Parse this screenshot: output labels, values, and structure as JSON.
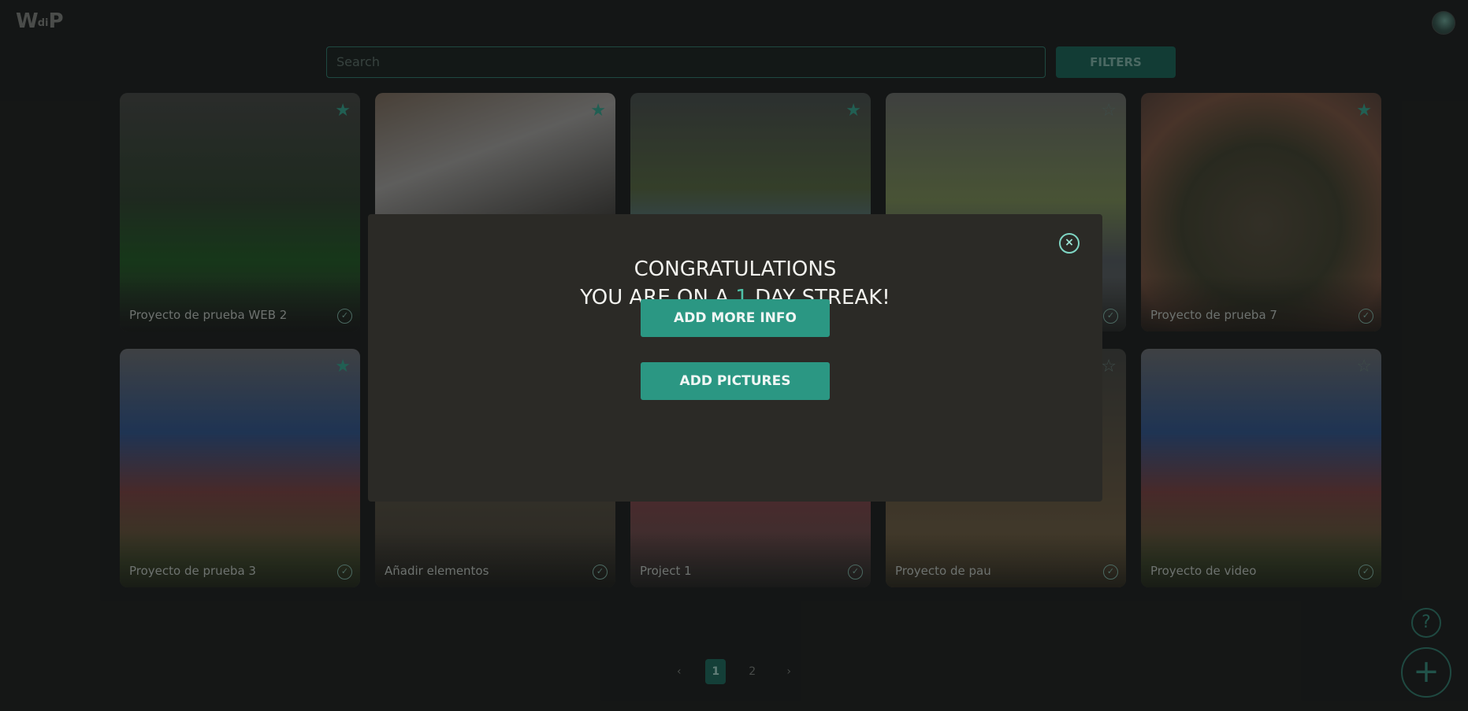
{
  "app": {
    "logo_main": "W",
    "logo_small": "di",
    "logo_end": "P"
  },
  "search": {
    "placeholder": "Search"
  },
  "filters_label": "FILTERS",
  "cards": [
    {
      "title": "Proyecto de prueba WEB 2",
      "favorite": true,
      "art": "linear-gradient(180deg,#3d3e3c 0%,#2a3a2a 45%,#1f4f22 70%,#2c2d2b 100%)"
    },
    {
      "title": "",
      "favorite": true,
      "art": "linear-gradient(160deg,#6b5d50 0%,#8c8a88 30%,#3c3a37 65%,#6d5a4b 100%)"
    },
    {
      "title": "",
      "favorite": true,
      "art": "linear-gradient(180deg,#3f4443 0%,#4c5a3a 40%,#4d6b8a 65%,#3a3b39 100%)"
    },
    {
      "title": "",
      "favorite": false,
      "art": "linear-gradient(180deg,#5b5d5a 0%,#6b7a4c 45%,#4a4f53 70%,#555755 100%)"
    },
    {
      "title": "Proyecto de prueba 7",
      "favorite": true,
      "art": "radial-gradient(circle at 50% 55%,#4a4336 0%,#3a3a2a 45%,#6b4a3a 75%,#4d3a33 100%)"
    },
    {
      "title": "Proyecto de prueba 3",
      "favorite": true,
      "art": "linear-gradient(180deg,#5c5e62 0%,#2b4a7a 35%,#6a3a3a 60%,#4a5430 90%)"
    },
    {
      "title": "Añadir elementos",
      "favorite": true,
      "art": "linear-gradient(180deg,#2f2f2c 0%,#4a4439 60%,#3a362e 100%)"
    },
    {
      "title": "Project 1",
      "favorite": true,
      "art": "linear-gradient(180deg,#45403d 0%,#6e3b3f 60%,#4d4643 100%)"
    },
    {
      "title": "Proyecto de pau",
      "favorite": false,
      "art": "linear-gradient(180deg,#3b3c3a 0%,#5a4d3a 65%,#6a5a3d 100%)"
    },
    {
      "title": "Proyecto de video",
      "favorite": false,
      "art": "linear-gradient(180deg,#5c5e62 0%,#2b4a7a 35%,#6a3a3a 60%,#4a5430 90%)"
    }
  ],
  "pagination": {
    "prev": "‹",
    "pages": [
      "1",
      "2"
    ],
    "next": "›",
    "current": "1"
  },
  "help_label": "?",
  "add_label": "+",
  "modal": {
    "line1": "CONGRATULATIONS",
    "line2_before": "YOU ARE ON A ",
    "streak": "1",
    "line2_after": " DAY STREAK!",
    "close_label": "×",
    "btn_info": "ADD MORE INFO",
    "btn_pictures": "ADD PICTURES"
  },
  "icons": {
    "star": "star-icon",
    "check": "check-circle-icon",
    "close": "close-icon",
    "help": "help-icon",
    "add": "plus-icon"
  },
  "colors": {
    "accent": "#2b9783",
    "streak": "#4fc1a8",
    "modal_bg": "#2b2a26"
  }
}
